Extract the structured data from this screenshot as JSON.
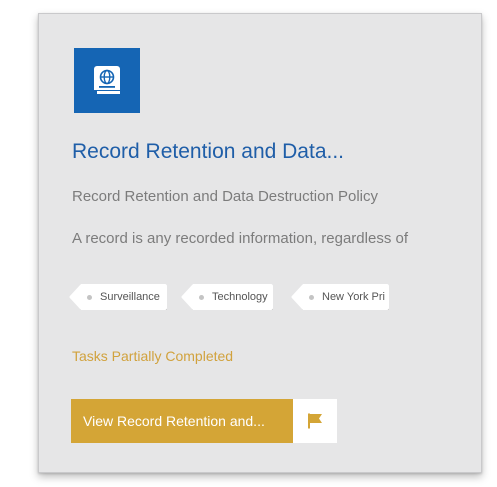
{
  "card": {
    "icon": "policy-book-globe-icon",
    "title": "Record Retention and Data...",
    "subtitle": "Record Retention and Data Destruction Policy",
    "description": "A record is any recorded information, regardless of",
    "tags": [
      "Surveillance",
      "Technology",
      "New York Pri"
    ],
    "status": "Tasks Partially Completed",
    "action_label": "View Record Retention and...",
    "flag_icon": "flag-icon"
  },
  "colors": {
    "accent_blue": "#1565b4",
    "title_blue": "#1f5ea8",
    "status_gold": "#d1a23d",
    "button_gold": "#d4a536",
    "card_bg": "#e6e6e7"
  }
}
